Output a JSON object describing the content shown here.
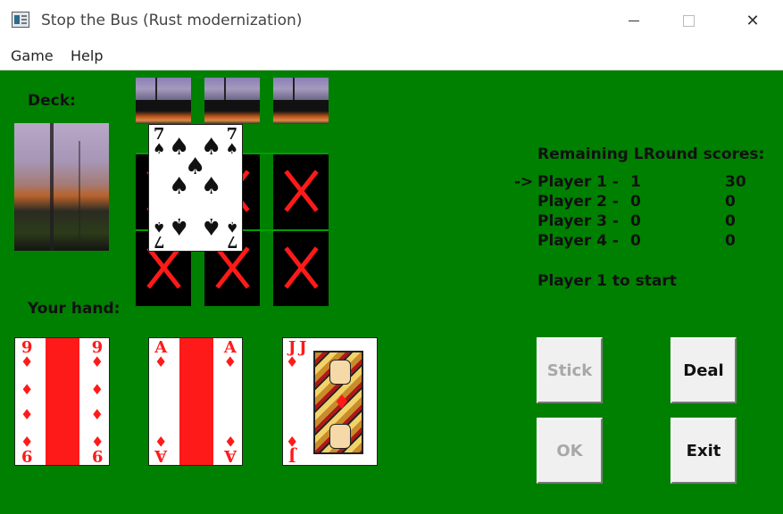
{
  "window": {
    "title": "Stop the Bus (Rust modernization)"
  },
  "menu": {
    "items": [
      "Game",
      "Help"
    ]
  },
  "labels": {
    "deck": "Deck:",
    "hand": "Your hand:"
  },
  "table_card": {
    "rank": "7",
    "suit": "♠"
  },
  "hand": [
    {
      "rank": "9",
      "suit": "♦"
    },
    {
      "rank": "A",
      "suit": "♦"
    },
    {
      "rank": "J",
      "suit": "♦"
    }
  ],
  "scores": {
    "header": "Remaining LRound scores:",
    "rows": [
      {
        "marker": "->",
        "name": "Player 1 -",
        "round": "1",
        "score": "30"
      },
      {
        "marker": "",
        "name": "Player 2 -",
        "round": "0",
        "score": "0"
      },
      {
        "marker": "",
        "name": "Player 3 -",
        "round": "0",
        "score": "0"
      },
      {
        "marker": "",
        "name": "Player 4 -",
        "round": "0",
        "score": "0"
      }
    ],
    "status": "Player 1 to start"
  },
  "buttons": {
    "stick": "Stick",
    "deal": "Deal",
    "ok": "OK",
    "exit": "Exit"
  },
  "colors": {
    "table_green": "#008000",
    "card_red": "#ff1a1a"
  }
}
